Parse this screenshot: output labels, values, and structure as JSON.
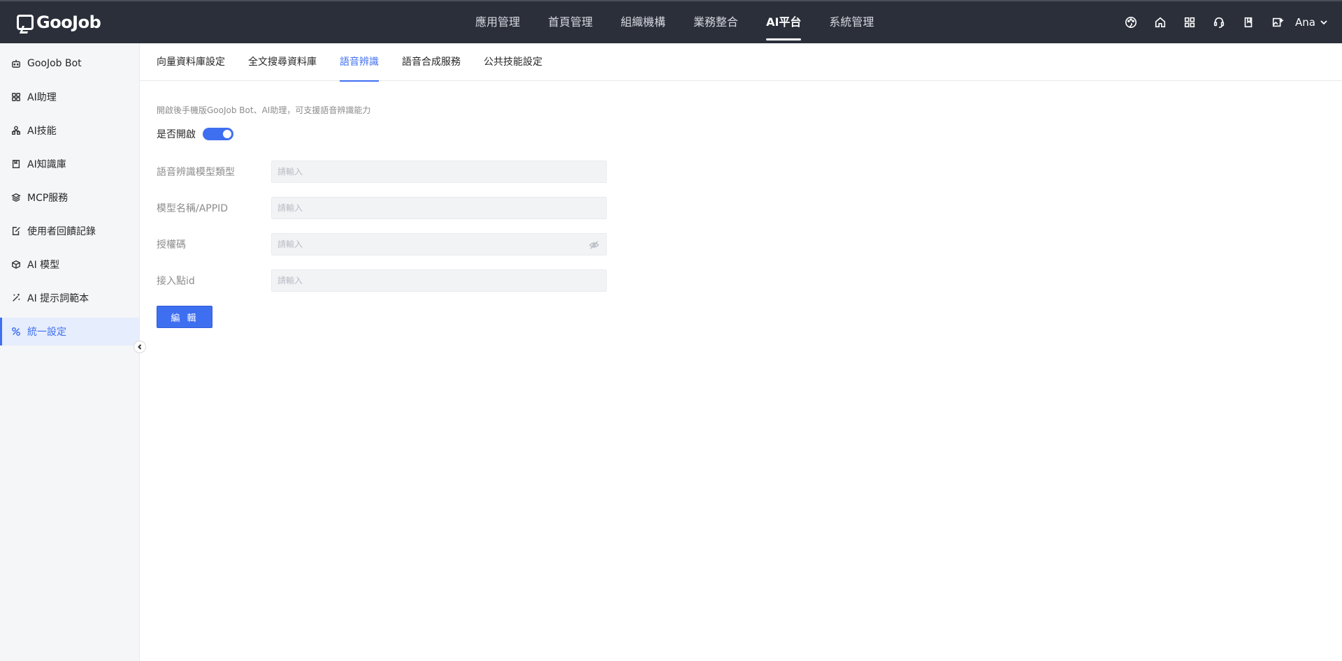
{
  "brand": {
    "logo_text": "GooJob"
  },
  "topnav": {
    "items": [
      {
        "label": "應用管理"
      },
      {
        "label": "首頁管理"
      },
      {
        "label": "組織機構"
      },
      {
        "label": "業務整合"
      },
      {
        "label": "AI平台"
      },
      {
        "label": "系統管理"
      }
    ],
    "active_index": 4
  },
  "user": {
    "name": "Ana"
  },
  "sidebar": {
    "items": [
      {
        "label": "GooJob Bot",
        "icon": "robot-icon"
      },
      {
        "label": "AI助理",
        "icon": "grid-icon"
      },
      {
        "label": "AI技能",
        "icon": "skill-icon"
      },
      {
        "label": "AI知識庫",
        "icon": "book-icon"
      },
      {
        "label": "MCP服務",
        "icon": "layers-icon"
      },
      {
        "label": "使用者回饋記錄",
        "icon": "edit-doc-icon"
      },
      {
        "label": "AI 模型",
        "icon": "cube-icon"
      },
      {
        "label": "AI 提示詞範本",
        "icon": "magic-wand-icon"
      },
      {
        "label": "統一設定",
        "icon": "tools-icon"
      }
    ],
    "active_index": 8
  },
  "tabs": {
    "items": [
      {
        "label": "向量資料庫設定"
      },
      {
        "label": "全文搜尋資料庫"
      },
      {
        "label": "語音辨識"
      },
      {
        "label": "語音合成服務"
      },
      {
        "label": "公共技能設定"
      }
    ],
    "active_index": 2
  },
  "form": {
    "description": "開啟後手機版GooJob Bot、AI助理，可支援語音辨識能力",
    "toggle_label": "是否開啟",
    "toggle_on": true,
    "fields": [
      {
        "label": "語音辨識模型類型",
        "placeholder": "請輸入",
        "value": ""
      },
      {
        "label": "模型名稱/APPID",
        "placeholder": "請輸入",
        "value": ""
      },
      {
        "label": "授權碼",
        "placeholder": "請輸入",
        "value": ""
      },
      {
        "label": "接入點id",
        "placeholder": "請輸入",
        "value": ""
      }
    ],
    "edit_button": "編 輯"
  },
  "colors": {
    "accent": "#3f6ff1",
    "topbar": "#2b2f3a",
    "sidebar_bg": "#f5f6f8"
  }
}
